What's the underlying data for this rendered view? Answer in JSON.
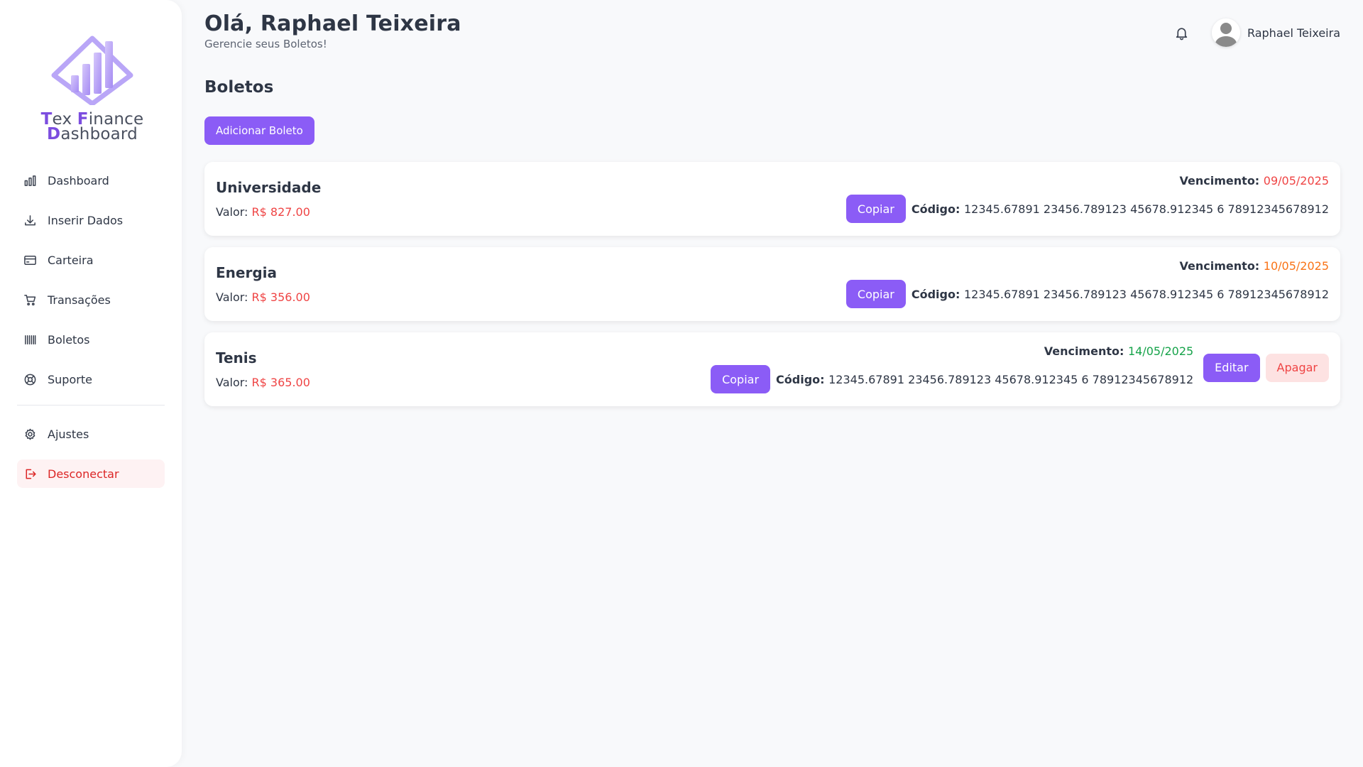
{
  "brand": {
    "line1_a": "T",
    "line1_b": "ex ",
    "line1_c": "F",
    "line1_d": "inance",
    "line2_a": "D",
    "line2_b": "ashboard",
    "accent": "#8b5cf6"
  },
  "sidebar": {
    "items": [
      {
        "label": "Dashboard",
        "icon": "bar-chart-icon"
      },
      {
        "label": "Inserir Dados",
        "icon": "download-icon"
      },
      {
        "label": "Carteira",
        "icon": "credit-card-icon"
      },
      {
        "label": "Transações",
        "icon": "cart-icon"
      },
      {
        "label": "Boletos",
        "icon": "barcode-icon"
      },
      {
        "label": "Suporte",
        "icon": "lifebuoy-icon"
      }
    ],
    "settings": {
      "label": "Ajustes",
      "icon": "gear-icon"
    },
    "logout": {
      "label": "Desconectar",
      "icon": "logout-icon",
      "color": "#dc2626"
    }
  },
  "header": {
    "greeting": "Olá, Raphael Teixeira",
    "subtitle": "Gerencie seus Boletos!",
    "user_name": "Raphael Teixeira"
  },
  "main": {
    "title": "Boletos",
    "add_button": "Adicionar Boleto",
    "labels": {
      "value": "Valor: ",
      "due": "Vencimento: ",
      "code": "Código: ",
      "copy": "Copiar",
      "edit": "Editar",
      "delete": "Apagar"
    },
    "bills": [
      {
        "name": "Universidade",
        "value": "R$ 827.00",
        "due": "09/05/2025",
        "due_status": "red",
        "code": "12345.67891 23456.789123 45678.912345 6 78912345678912"
      },
      {
        "name": "Energia",
        "value": "R$ 356.00",
        "due": "10/05/2025",
        "due_status": "orange",
        "code": "12345.67891 23456.789123 45678.912345 6 78912345678912"
      },
      {
        "name": "Tenis",
        "value": "R$ 365.00",
        "due": "14/05/2025",
        "due_status": "green",
        "code": "12345.67891 23456.789123 45678.912345 6 78912345678912"
      }
    ]
  },
  "colors": {
    "primary": "#8b5cf6",
    "danger": "#ef4444",
    "warning": "#f97316",
    "success": "#16a34a"
  }
}
